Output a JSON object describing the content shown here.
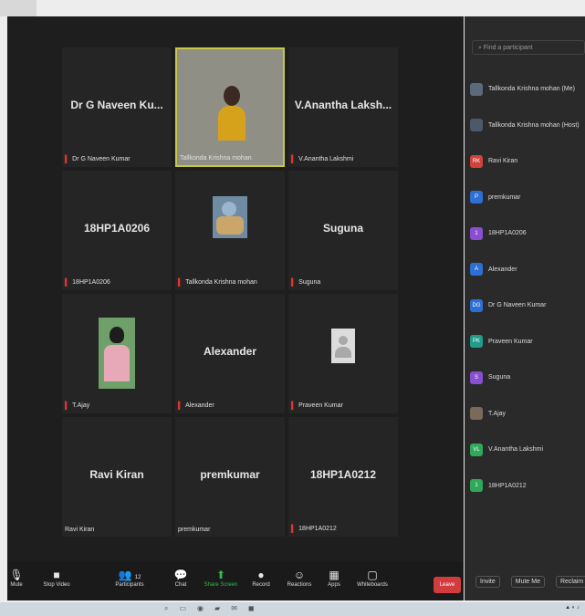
{
  "grid": {
    "tiles": [
      {
        "display": "Dr G Naveen Ku...",
        "tag": "Dr G Naveen Kumar",
        "muted": true,
        "kind": "name"
      },
      {
        "display": "",
        "tag": "Tallkonda Krishna mohan",
        "muted": false,
        "kind": "video"
      },
      {
        "display": "V.Anantha Laksh...",
        "tag": "V.Anantha Lakshmi",
        "muted": true,
        "kind": "name"
      },
      {
        "display": "18HP1A0206",
        "tag": "18HP1A0206",
        "muted": true,
        "kind": "name"
      },
      {
        "display": "",
        "tag": "Tallkonda Krishna mohan",
        "muted": true,
        "kind": "thumb"
      },
      {
        "display": "Suguna",
        "tag": "Suguna",
        "muted": true,
        "kind": "name"
      },
      {
        "display": "",
        "tag": "T.Ajay",
        "muted": true,
        "kind": "photo"
      },
      {
        "display": "Alexander",
        "tag": "Alexander",
        "muted": true,
        "kind": "name"
      },
      {
        "display": "",
        "tag": "Praveen Kumar",
        "muted": true,
        "kind": "placeholder"
      },
      {
        "display": "Ravi Kiran",
        "tag": "Ravi Kiran",
        "muted": false,
        "kind": "name"
      },
      {
        "display": "premkumar",
        "tag": "premkumar",
        "muted": false,
        "kind": "name"
      },
      {
        "display": "18HP1A0212",
        "tag": "18HP1A0212",
        "muted": true,
        "kind": "name"
      }
    ]
  },
  "toolbar": {
    "unmute": "Mute",
    "stop_video": "Stop Video",
    "participants": "Participants",
    "participants_count": "12",
    "chat": "Chat",
    "share_screen": "Share Screen",
    "record": "Record",
    "reactions": "Reactions",
    "apps": "Apps",
    "whiteboards": "Whiteboards",
    "leave": "Leave"
  },
  "panel": {
    "search_placeholder": "Find a participant",
    "participants": [
      {
        "name": "Tallkonda Krishna mohan (Me)",
        "initials": "",
        "color": "#5a6a7a"
      },
      {
        "name": "Tallkonda Krishna mohan (Host)",
        "initials": "",
        "color": "#4a5a6a"
      },
      {
        "name": "Ravi Kiran",
        "initials": "RK",
        "color": "#d0433b"
      },
      {
        "name": "premkumar",
        "initials": "P",
        "color": "#2e6fd6"
      },
      {
        "name": "18HP1A0206",
        "initials": "1",
        "color": "#8a4fd0"
      },
      {
        "name": "Alexander",
        "initials": "A",
        "color": "#2e6fd6"
      },
      {
        "name": "Dr G Naveen Kumar",
        "initials": "DG",
        "color": "#2e6fd6"
      },
      {
        "name": "Praveen Kumar",
        "initials": "PK",
        "color": "#1f9d8a"
      },
      {
        "name": "Suguna",
        "initials": "S",
        "color": "#8a4fd0"
      },
      {
        "name": "T.Ajay",
        "initials": "",
        "color": "#7a6a5a"
      },
      {
        "name": "V.Anantha Lakshmi",
        "initials": "VL",
        "color": "#2fa85a"
      },
      {
        "name": "18HP1A0212",
        "initials": "1",
        "color": "#2fa85a"
      }
    ],
    "invite": "Invite",
    "mute_me": "Mute Me",
    "reclaim_host": "Reclaim Ho"
  },
  "colors": {
    "meeting_bg": "#1e1e1e",
    "tile_bg": "#252525",
    "active_border": "#c7c84a",
    "share_green": "#2fbf4a",
    "leave_red": "#d13c3c"
  }
}
